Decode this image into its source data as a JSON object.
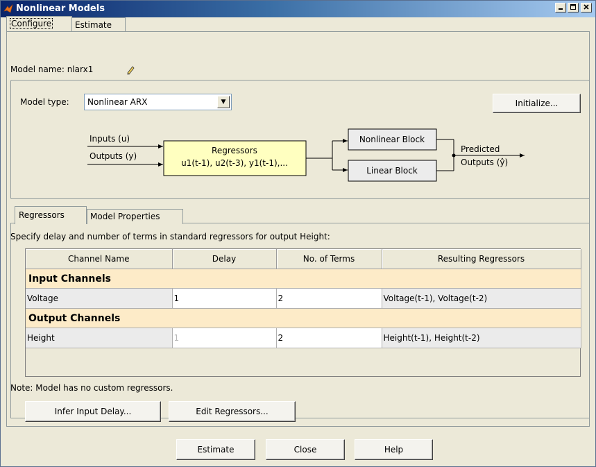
{
  "window": {
    "title": "Nonlinear Models"
  },
  "main_tabs": [
    {
      "label": "Configure"
    },
    {
      "label": "Estimate"
    }
  ],
  "model": {
    "name_label": "Model name: nlarx1",
    "type_label": "Model type:",
    "type_value": "Nonlinear ARX",
    "initialize_label": "Initialize..."
  },
  "diagram": {
    "inputs_label": "Inputs (u)",
    "outputs_label": "Outputs (y)",
    "regressors_title": "Regressors",
    "regressors_sub": "u1(t-1), u2(t-3), y1(t-1),...",
    "nonlinear_block": "Nonlinear Block",
    "linear_block": "Linear Block",
    "predicted_line1": "Predicted",
    "predicted_line2": "Outputs (ŷ)"
  },
  "sub_tabs": [
    {
      "label": "Regressors"
    },
    {
      "label": "Model Properties"
    }
  ],
  "regressors": {
    "instruction": "Specify delay and number of terms in standard regressors for output Height:",
    "columns": [
      "Channel Name",
      "Delay",
      "No. of Terms",
      "Resulting Regressors"
    ],
    "input_group": "Input Channels",
    "input_row": {
      "name": "Voltage",
      "delay": "1",
      "terms": "2",
      "result": "Voltage(t-1), Voltage(t-2)"
    },
    "output_group": "Output Channels",
    "output_row": {
      "name": "Height",
      "delay": "1",
      "terms": "2",
      "result": "Height(t-1), Height(t-2)"
    },
    "note": "Note: Model has no custom regressors.",
    "infer_label": "Infer Input Delay...",
    "edit_label": "Edit Regressors..."
  },
  "footer": {
    "estimate_label": "Estimate",
    "close_label": "Close",
    "help_label": "Help"
  }
}
